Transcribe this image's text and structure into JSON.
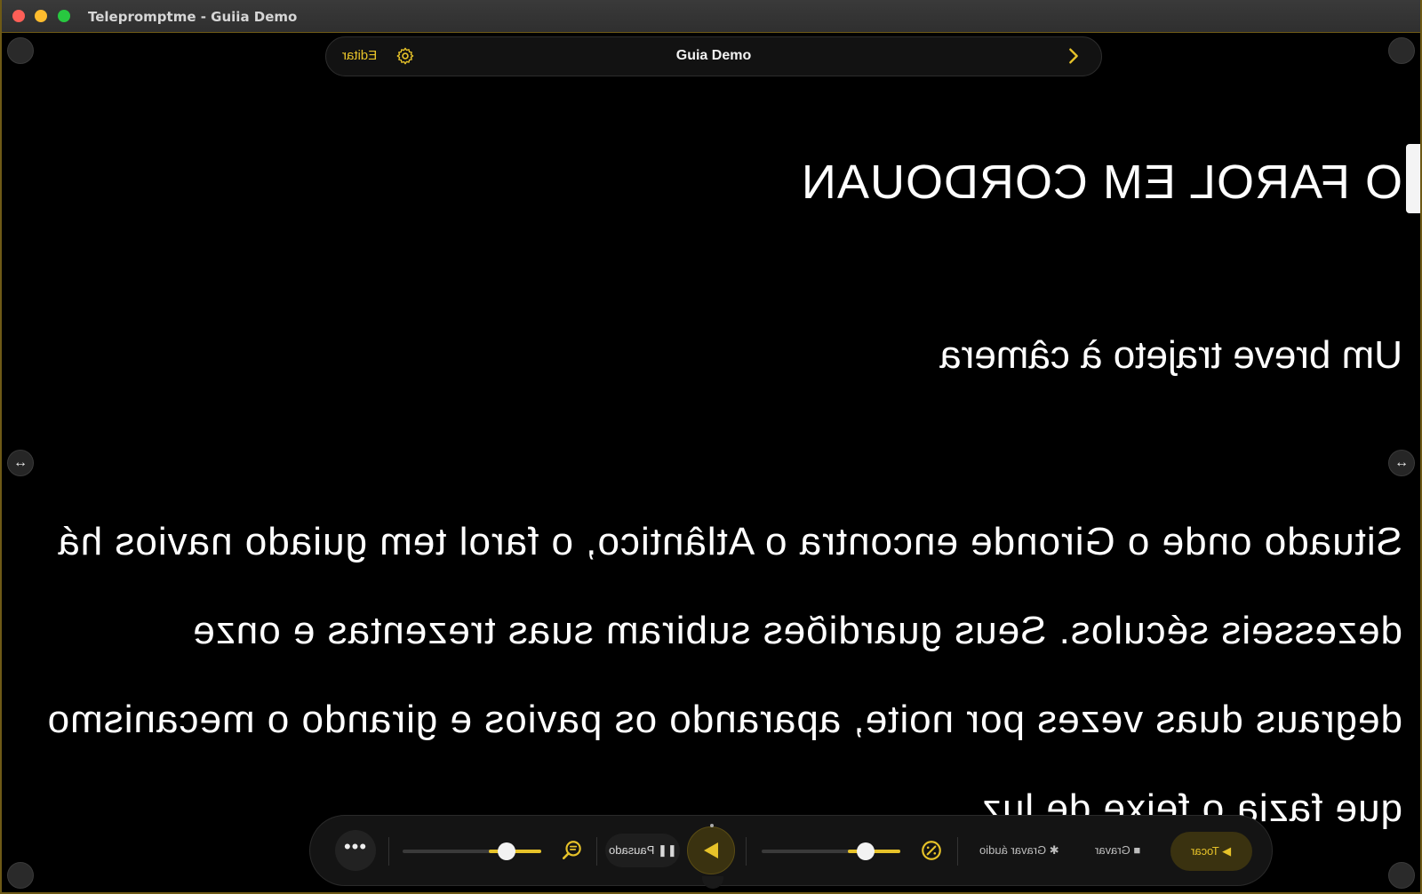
{
  "window": {
    "title": "Telepromptme - Guiia Demo"
  },
  "topbar": {
    "edit_label": "Editar",
    "script_title": "Guia Demo"
  },
  "prompter": {
    "title": "O FAROL EM CORDOUAN",
    "subtitle": "Um breve trajeto à câmera",
    "body": "Situado onde o Gironde encontra o Atlântico, o farol tem guiado navios há dezesseis séculos. Seus guardiões subiram suas trezentas e onze degraus duas vezes por noite, aparando os pavios e girando o mecanismo que fazia o feixe de luz",
    "mirrored": true
  },
  "controls": {
    "more_label": "•••",
    "speed_slider": 0.75,
    "font_slider": 0.75,
    "status_label": "Pausado",
    "record_video_label": "Gravar",
    "record_audio_label": "Gravar áudio",
    "play_label": "Tocar"
  },
  "colors": {
    "accent": "#e6c229",
    "background": "#000000",
    "text": "#ffffff"
  },
  "icons": [
    "gear-icon",
    "chevron-right-icon",
    "arrows-horizontal-icon",
    "zoom-text-icon",
    "speed-gauge-icon",
    "pause-icon",
    "play-icon",
    "camera-icon",
    "microphone-icon"
  ]
}
